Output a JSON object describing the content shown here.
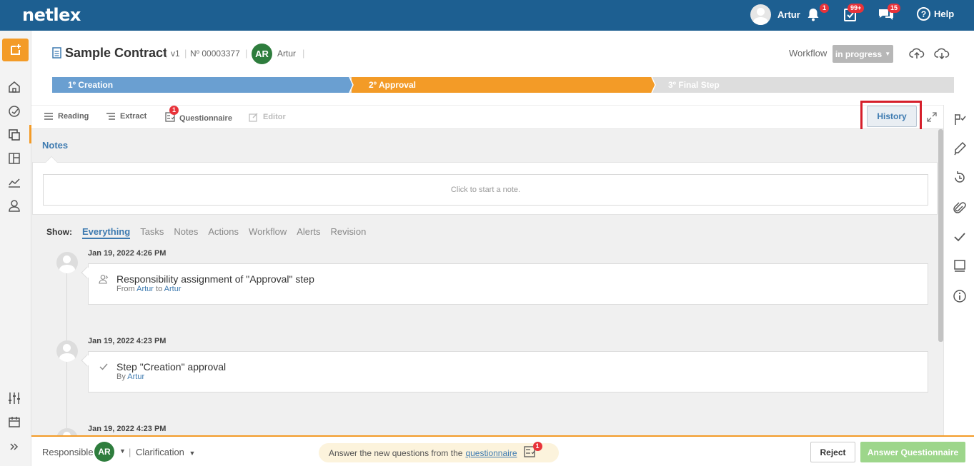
{
  "app": {
    "logo": "netlex"
  },
  "topbar": {
    "user_name": "Artur",
    "notifications_count": "1",
    "tasks_count": "99+",
    "messages_count": "15",
    "help_label": "Help",
    "help_glyph": "?"
  },
  "document": {
    "title": "Sample Contract",
    "version": "v1",
    "number": "Nº 00003377",
    "owner_initials": "AR",
    "owner_name": "Artur",
    "workflow_label": "Workflow",
    "workflow_status": "in progress"
  },
  "steps": [
    {
      "label": "1º Creation",
      "color": "#6a9fd1"
    },
    {
      "label": "2º Approval",
      "color": "#f39b27"
    },
    {
      "label": "3º Final Step",
      "color": "#dddddd"
    }
  ],
  "toolbar": {
    "reading": "Reading",
    "extract": "Extract",
    "questionnaire": "Questionnaire",
    "questionnaire_badge": "1",
    "editor": "Editor",
    "history": "History"
  },
  "notes": {
    "title": "Notes",
    "placeholder": "Click to start a note."
  },
  "filters": {
    "show_label": "Show:",
    "items": [
      "Everything",
      "Tasks",
      "Notes",
      "Actions",
      "Workflow",
      "Alerts",
      "Revision"
    ],
    "active": "Everything"
  },
  "timeline": [
    {
      "date": "Jan 19, 2022 4:26 PM",
      "icon": "user-assign-icon",
      "title": "Responsibility assignment of \"Approval\" step",
      "sub_prefix": "From",
      "sub_from": "Artur",
      "sub_mid": "to",
      "sub_to": "Artur"
    },
    {
      "date": "Jan 19, 2022 4:23 PM",
      "icon": "check-icon",
      "title": "Step \"Creation\" approval",
      "sub_prefix": "By",
      "sub_from": "Artur"
    },
    {
      "date": "Jan 19, 2022 4:23 PM"
    }
  ],
  "bottombar": {
    "responsible_label": "Responsible",
    "responsible_initials": "AR",
    "sep": "|",
    "clarification_label": "Clarification",
    "message_prefix": "Answer the new questions from the",
    "message_link": "questionnaire",
    "message_badge": "1",
    "reject_label": "Reject",
    "answer_label": "Answer Questionnaire"
  },
  "colors": {
    "brand": "#1d5f91",
    "accent": "#f39b27",
    "link": "#3d7ab0",
    "badge": "#e8333a",
    "avatar": "#2e7d3d"
  }
}
